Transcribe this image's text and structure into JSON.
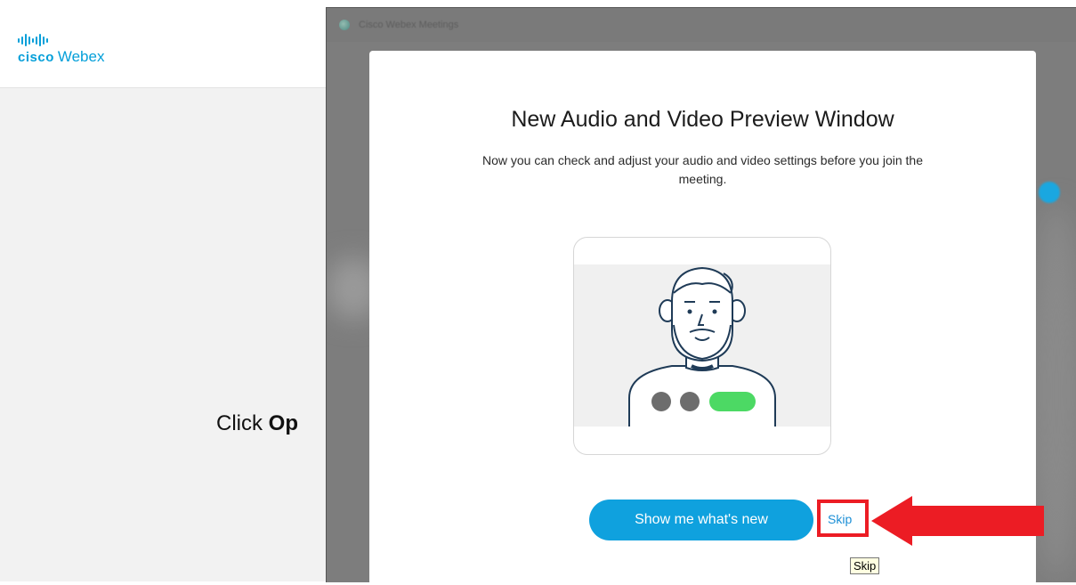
{
  "background_page": {
    "logo": {
      "cisco": "cisco",
      "product": "Webex"
    },
    "click_text_prefix": "Click ",
    "click_text_bold": "Op"
  },
  "app_window": {
    "title": "Cisco Webex Meetings"
  },
  "modal": {
    "title": "New Audio and Video Preview Window",
    "description": "Now you can check and adjust your audio and video settings before you join the meeting.",
    "primary_button": "Show me what's new",
    "skip_link": "Skip",
    "tooltip": "Skip"
  },
  "colors": {
    "brand_blue": "#049fd9",
    "primary_button": "#0fa1de",
    "highlight_red": "#ec1c24",
    "video_on_green": "#4cd964",
    "illustration_outline": "#1f3b57"
  },
  "icons": [
    "cisco-logo-icon",
    "app-icon",
    "person-illustration",
    "callout-arrow-icon"
  ]
}
